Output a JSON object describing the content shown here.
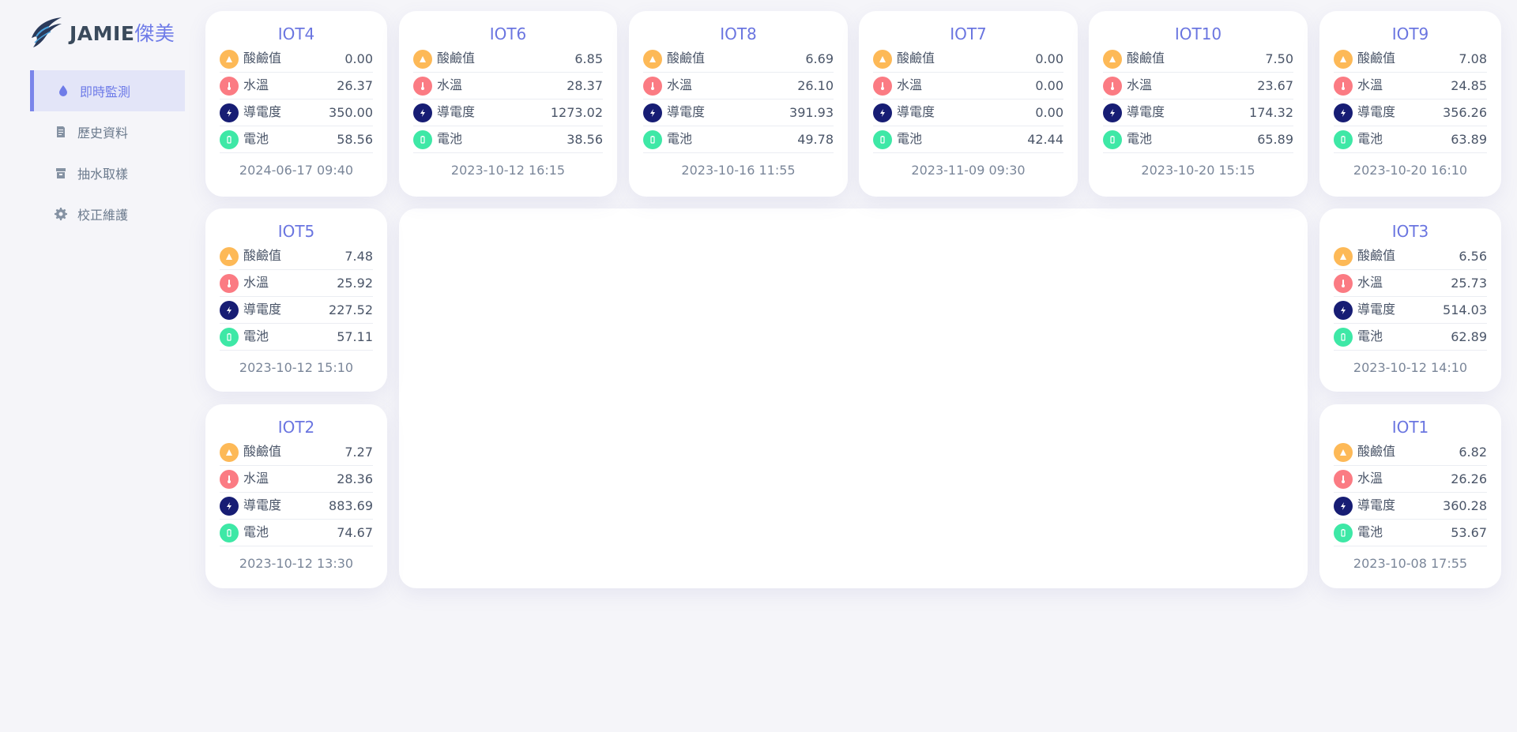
{
  "brand": {
    "name": "JAMIE",
    "name_cn": "傑美"
  },
  "menu": [
    {
      "label": "即時監測",
      "icon": "water-drop-icon",
      "active": true
    },
    {
      "label": "歷史資料",
      "icon": "document-icon",
      "active": false
    },
    {
      "label": "抽水取樣",
      "icon": "archive-box-icon",
      "active": false
    },
    {
      "label": "校正維護",
      "icon": "gear-icon",
      "active": false
    }
  ],
  "metric_labels": {
    "ph": "酸鹼值",
    "temp": "水溫",
    "cond": "導電度",
    "batt": "電池"
  },
  "colors": {
    "accent": "#6f7ce8",
    "ph": "#fdb957",
    "temp": "#fb7b83",
    "cond": "#171d74",
    "batt": "#3ee8a6"
  },
  "devices": {
    "iot4": {
      "name": "IOT4",
      "ph": "0.00",
      "temp": "26.37",
      "cond": "350.00",
      "batt": "58.56",
      "time": "2024-06-17 09:40"
    },
    "iot6": {
      "name": "IOT6",
      "ph": "6.85",
      "temp": "28.37",
      "cond": "1273.02",
      "batt": "38.56",
      "time": "2023-10-12 16:15"
    },
    "iot8": {
      "name": "IOT8",
      "ph": "6.69",
      "temp": "26.10",
      "cond": "391.93",
      "batt": "49.78",
      "time": "2023-10-16 11:55"
    },
    "iot7": {
      "name": "IOT7",
      "ph": "0.00",
      "temp": "0.00",
      "cond": "0.00",
      "batt": "42.44",
      "time": "2023-11-09 09:30"
    },
    "iot10": {
      "name": "IOT10",
      "ph": "7.50",
      "temp": "23.67",
      "cond": "174.32",
      "batt": "65.89",
      "time": "2023-10-20 15:15"
    },
    "iot9": {
      "name": "IOT9",
      "ph": "7.08",
      "temp": "24.85",
      "cond": "356.26",
      "batt": "63.89",
      "time": "2023-10-20 16:10"
    },
    "iot5": {
      "name": "IOT5",
      "ph": "7.48",
      "temp": "25.92",
      "cond": "227.52",
      "batt": "57.11",
      "time": "2023-10-12 15:10"
    },
    "iot3": {
      "name": "IOT3",
      "ph": "6.56",
      "temp": "25.73",
      "cond": "514.03",
      "batt": "62.89",
      "time": "2023-10-12 14:10"
    },
    "iot2": {
      "name": "IOT2",
      "ph": "7.27",
      "temp": "28.36",
      "cond": "883.69",
      "batt": "74.67",
      "time": "2023-10-12 13:30"
    },
    "iot1": {
      "name": "IOT1",
      "ph": "6.82",
      "temp": "26.26",
      "cond": "360.28",
      "batt": "53.67",
      "time": "2023-10-08 17:55"
    }
  }
}
